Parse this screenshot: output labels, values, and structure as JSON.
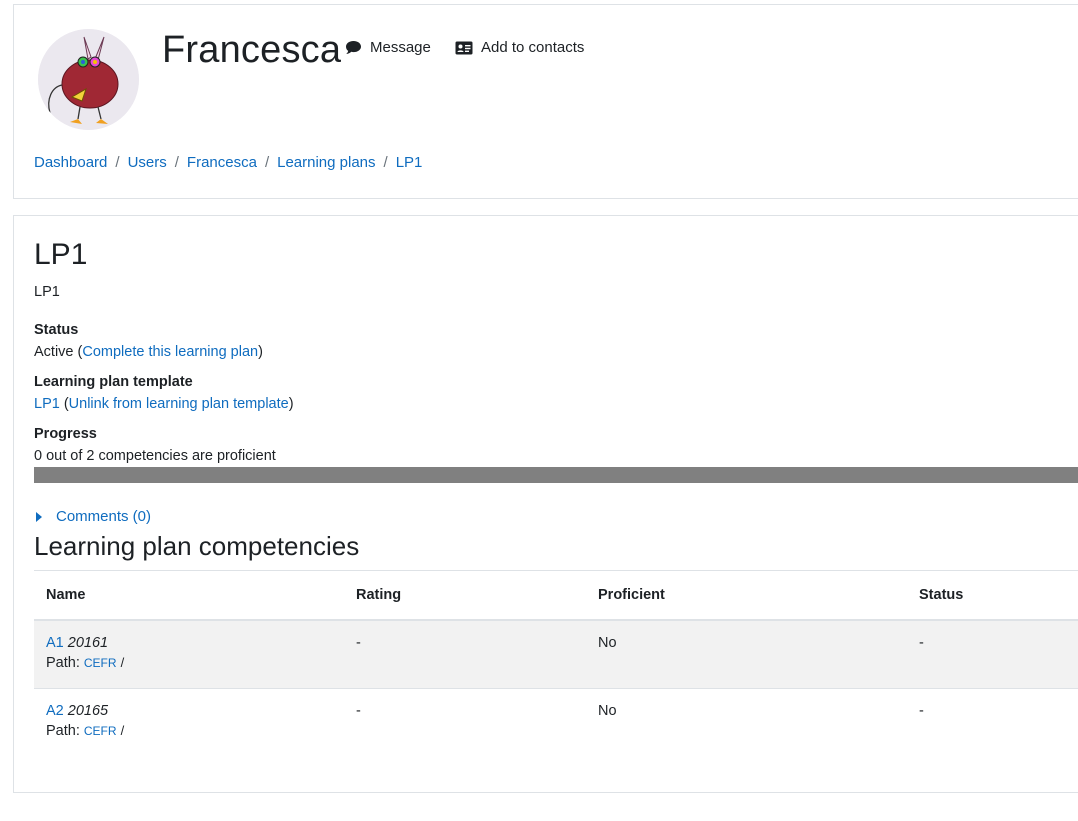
{
  "header": {
    "user_name": "Francesca",
    "message_label": "Message",
    "add_contacts_label": "Add to contacts"
  },
  "breadcrumb": {
    "items": [
      "Dashboard",
      "Users",
      "Francesca",
      "Learning plans",
      "LP1"
    ],
    "separator": "/"
  },
  "plan": {
    "title": "LP1",
    "description": "LP1",
    "status_label": "Status",
    "status_value": "Active",
    "complete_link": "Complete this learning plan",
    "template_label": "Learning plan template",
    "template_link": "LP1",
    "unlink_link": "Unlink from learning plan template",
    "progress_label": "Progress",
    "progress_text": "0 out of 2 competencies are proficient",
    "progress_fraction": 0,
    "comments_label": "Comments (0)"
  },
  "competencies": {
    "section_title": "Learning plan competencies",
    "columns": [
      "Name",
      "Rating",
      "Proficient",
      "Status"
    ],
    "path_label": "Path:",
    "rows": [
      {
        "short": "A1",
        "id": "20161",
        "framework": "CEFR",
        "rating": "-",
        "proficient": "No",
        "status": "-"
      },
      {
        "short": "A2",
        "id": "20165",
        "framework": "CEFR",
        "rating": "-",
        "proficient": "No",
        "status": "-"
      }
    ]
  },
  "colors": {
    "link": "#0f6cbf",
    "progress_track": "#808080",
    "row_stripe": "#f2f2f2"
  },
  "icons": {
    "message": "speech-bubble-icon",
    "contacts": "address-card-icon",
    "comments_toggle": "caret-right-icon"
  }
}
